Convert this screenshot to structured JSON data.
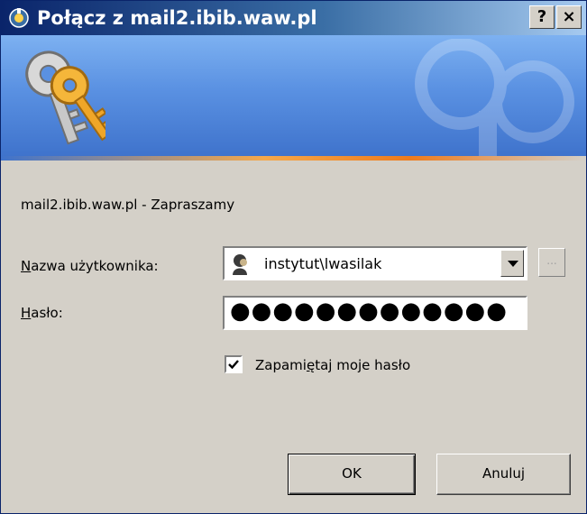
{
  "window": {
    "title": "Połącz z mail2.ibib.waw.pl"
  },
  "titlebar": {
    "help_label": "?",
    "close_label": "×"
  },
  "dialog": {
    "welcome_text": "mail2.ibib.waw.pl - Zapraszamy",
    "username": {
      "label_accel": "N",
      "label_rest": "azwa użytkownika:",
      "value": "instytut\\lwasilak",
      "browse_label": "..."
    },
    "password": {
      "label_accel": "H",
      "label_rest": "asło:",
      "masked_value": "●●●●●●●●●●●●●"
    },
    "remember": {
      "label_before": "Zapami",
      "label_accel": "ę",
      "label_after": "taj moje hasło",
      "checked": true
    },
    "ok_label": "OK",
    "cancel_label": "Anuluj"
  },
  "colors": {
    "titlebar_start": "#0a246a",
    "titlebar_end": "#a6caf0",
    "banner": "#5a91e2",
    "accent_line": "#ee7b1c",
    "dialog_bg": "#d4d0c8"
  },
  "icons": [
    "keys-icon",
    "user-icon",
    "dropdown-arrow-icon",
    "check-icon"
  ]
}
